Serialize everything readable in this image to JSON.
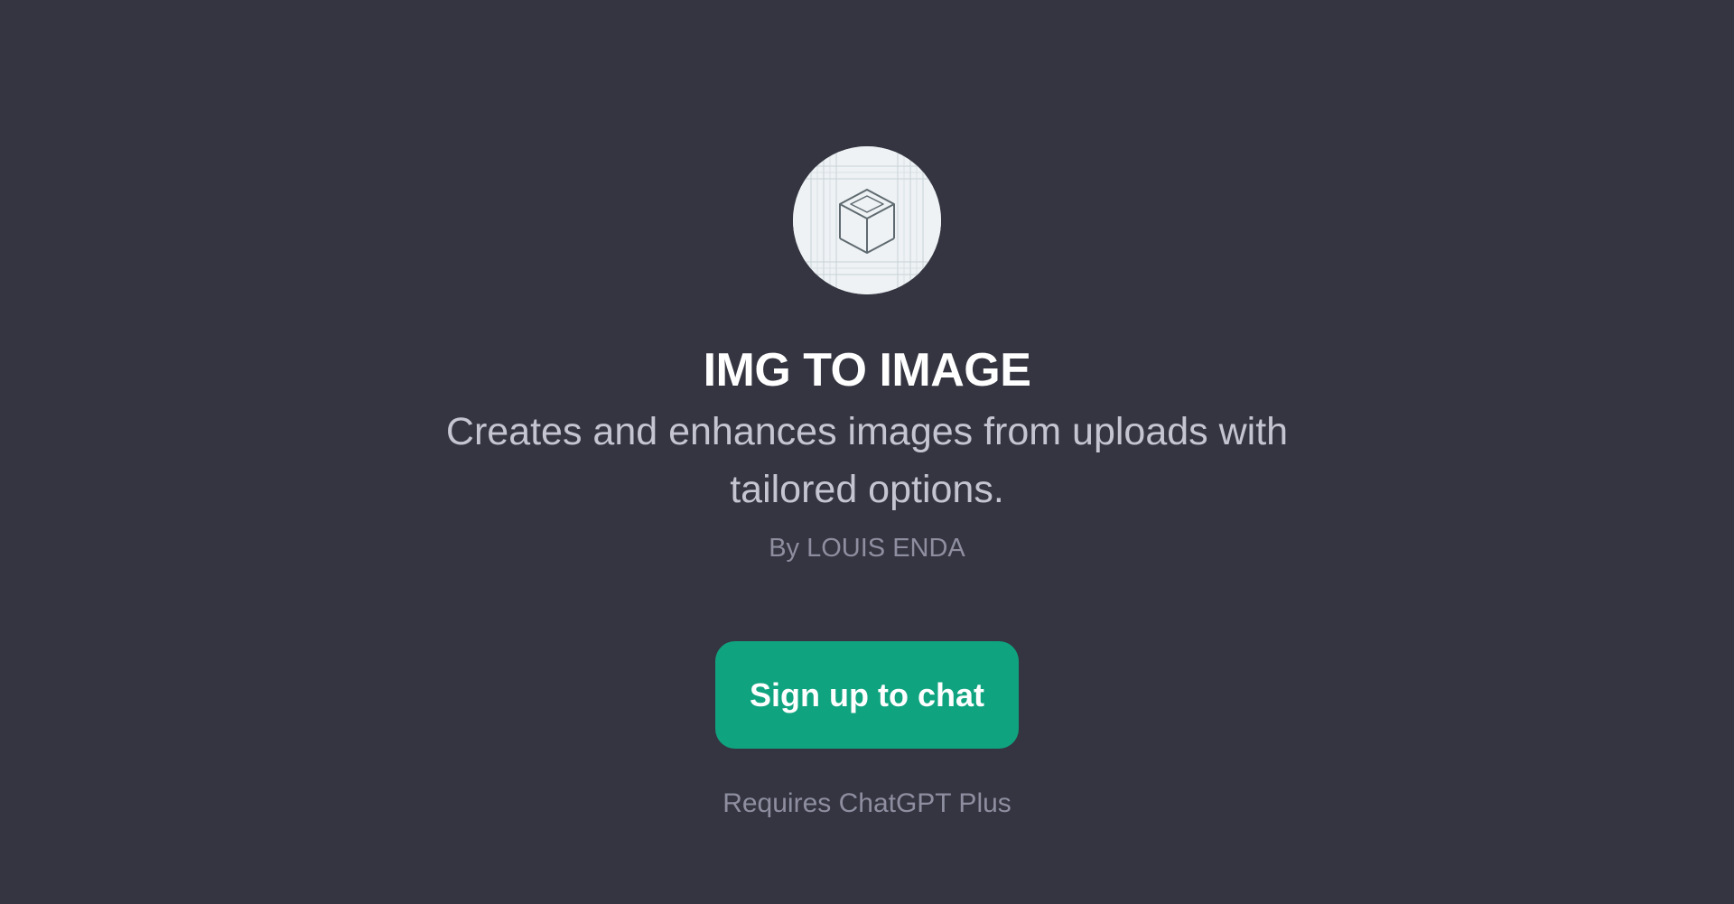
{
  "gpt": {
    "title": "IMG TO IMAGE",
    "description": "Creates and enhances images from uploads with tailored options.",
    "author": "By LOUIS ENDA",
    "avatar_icon": "wireframe-cube-icon"
  },
  "cta": {
    "label": "Sign up to chat",
    "note": "Requires ChatGPT Plus"
  },
  "colors": {
    "background": "#343541",
    "accent": "#10a37f",
    "title": "#ffffff",
    "description": "#c5c5d2",
    "muted": "#8e8ea0"
  }
}
